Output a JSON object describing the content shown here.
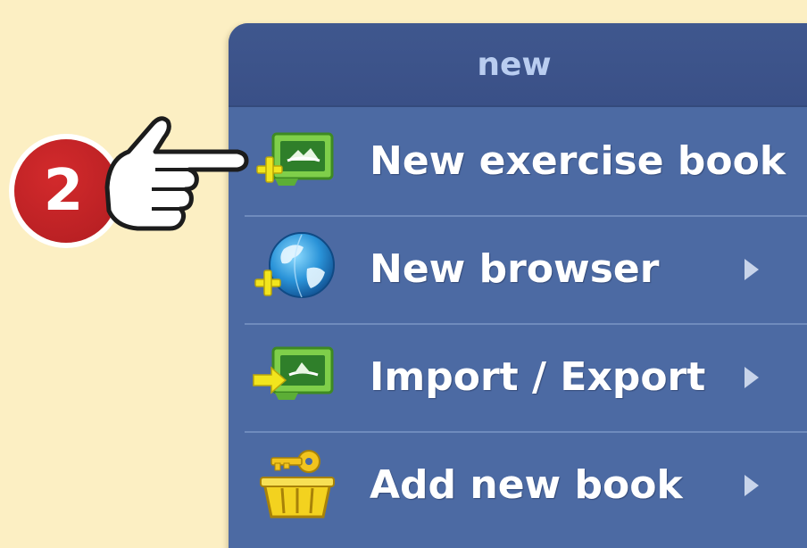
{
  "menu": {
    "title": "new",
    "items": [
      {
        "label": "New exercise book",
        "icon": "new-exercise-book-icon",
        "has_submenu": false
      },
      {
        "label": "New browser",
        "icon": "new-browser-globe-icon",
        "has_submenu": true
      },
      {
        "label": "Import / Export",
        "icon": "import-export-icon",
        "has_submenu": true
      },
      {
        "label": "Add new book",
        "icon": "add-book-basket-icon",
        "has_submenu": true
      }
    ]
  },
  "callout": {
    "step_number": "2",
    "pointer": "pointing-hand-icon"
  },
  "colors": {
    "background": "#fcefc3",
    "menu_body": "#4c6aa3",
    "menu_header": "#3f578e",
    "header_text": "#b9cdf0",
    "badge_red": "#c42326"
  }
}
